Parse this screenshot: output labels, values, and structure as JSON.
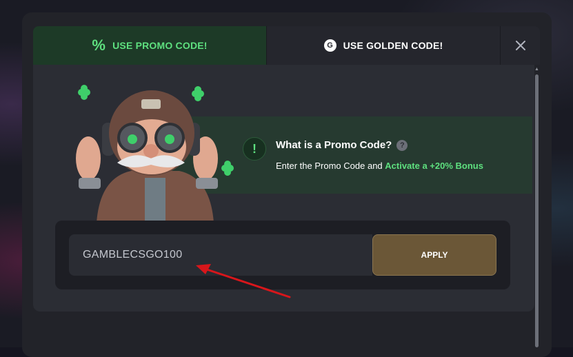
{
  "tabs": {
    "promo_label": "USE PROMO CODE!",
    "golden_label": "USE GOLDEN CODE!",
    "golden_icon_letter": "G",
    "promo_icon": "percent-icon",
    "close_icon": "close-icon"
  },
  "info": {
    "icon_text": "!",
    "title": "What is a Promo Code?",
    "help_icon_text": "?",
    "desc_prefix": "Enter the Promo Code and ",
    "desc_highlight": "Activate a +20% Bonus"
  },
  "promo": {
    "code_value": "GAMBLECSGO100",
    "apply_label": "APPLY"
  },
  "colors": {
    "accent_green": "#5ee07f",
    "apply_gold": "#6b5737",
    "annotation_red": "#d8161b"
  }
}
